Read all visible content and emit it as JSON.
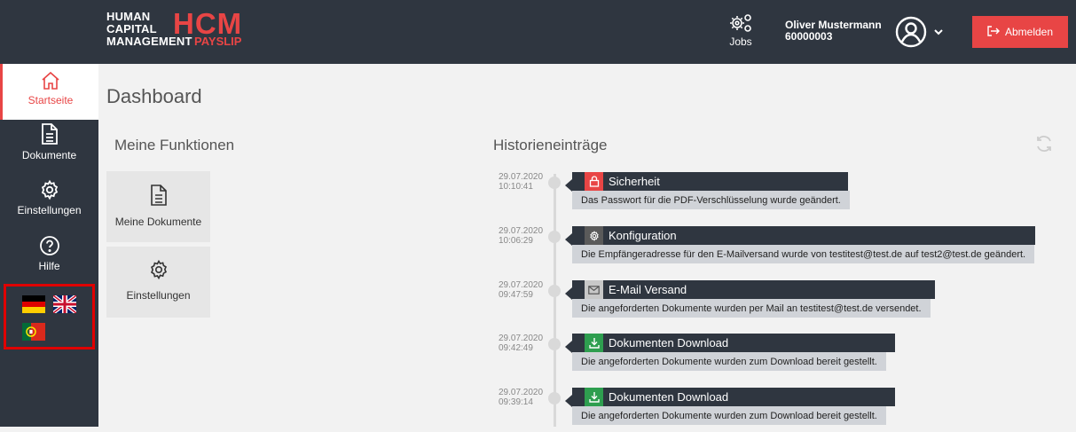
{
  "header": {
    "logo": {
      "line1": "HUMAN",
      "line2": "CAPITAL",
      "line3": "MANAGEMENT",
      "big": "HCM",
      "sub": "PAYSLIP"
    },
    "jobs_label": "Jobs",
    "user_name": "Oliver Mustermann",
    "user_id": "60000003",
    "logout_label": "Abmelden"
  },
  "sidebar": {
    "items": [
      {
        "label": "Startseite",
        "icon": "home-icon",
        "active": true
      },
      {
        "label": "Dokumente",
        "icon": "document-icon"
      },
      {
        "label": "Einstellungen",
        "icon": "gear-icon"
      },
      {
        "label": "Hilfe",
        "icon": "help-icon"
      }
    ],
    "languages": [
      "de",
      "en",
      "pt"
    ]
  },
  "main": {
    "page_title": "Dashboard",
    "functions_title": "Meine Funktionen",
    "functions": [
      {
        "label": "Meine Dokumente",
        "icon": "document-icon"
      },
      {
        "label": "Einstellungen",
        "icon": "gear-icon"
      }
    ],
    "history_title": "Historieneinträge",
    "history": [
      {
        "date": "29.07.2020",
        "time": "10:10:41",
        "category": "Sicherheit",
        "icon": "lock-icon",
        "icon_color": "#e84545",
        "text": "Das Passwort für die PDF-Verschlüsselung wurde geändert."
      },
      {
        "date": "29.07.2020",
        "time": "10:06:29",
        "category": "Konfiguration",
        "icon": "gear-icon",
        "icon_color": "#5a5a5a",
        "text": "Die Empfängeradresse für den E-Mailversand wurde von testitest@test.de auf test2@test.de geändert."
      },
      {
        "date": "29.07.2020",
        "time": "09:47:59",
        "category": "E-Mail Versand",
        "icon": "mail-icon",
        "icon_color": "#c8c8c8",
        "text": "Die angeforderten Dokumente wurden per Mail an testitest@test.de versendet."
      },
      {
        "date": "29.07.2020",
        "time": "09:42:49",
        "category": "Dokumenten Download",
        "icon": "download-icon",
        "icon_color": "#2e9e4f",
        "text": "Die angeforderten Dokumente wurden zum Download bereit gestellt."
      },
      {
        "date": "29.07.2020",
        "time": "09:39:14",
        "category": "Dokumenten Download",
        "icon": "download-icon",
        "icon_color": "#2e9e4f",
        "text": "Die angeforderten Dokumente wurden zum Download bereit gestellt."
      }
    ]
  },
  "colors": {
    "accent": "#e84545",
    "dark": "#2f3640",
    "highlight_box": "#e00000"
  }
}
